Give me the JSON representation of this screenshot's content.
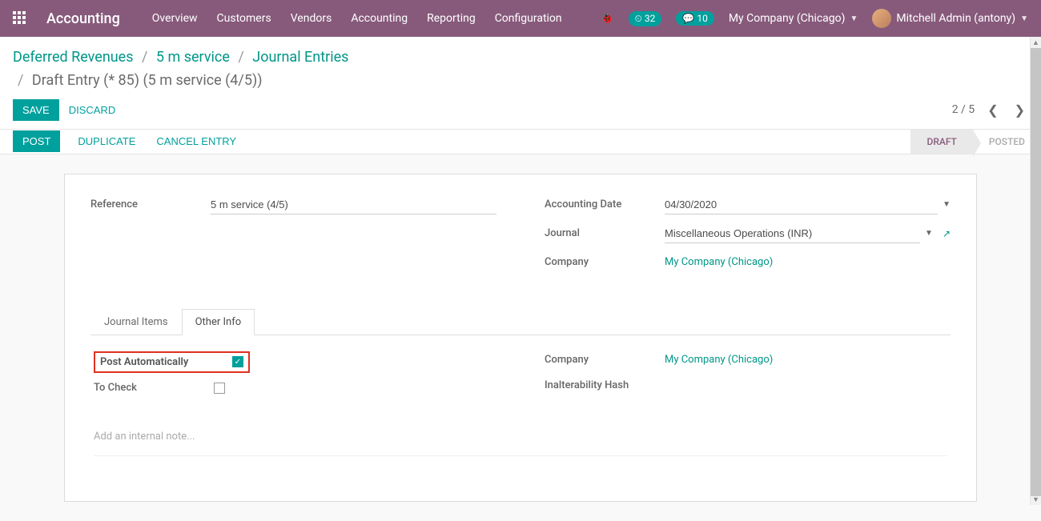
{
  "navbar": {
    "app_name": "Accounting",
    "menu": [
      "Overview",
      "Customers",
      "Vendors",
      "Accounting",
      "Reporting",
      "Configuration"
    ],
    "activity_count": "32",
    "message_count": "10",
    "company": "My Company (Chicago)",
    "user": "Mitchell Admin (antony)"
  },
  "breadcrumb": {
    "items": [
      "Deferred Revenues",
      "5 m service",
      "Journal Entries"
    ],
    "current": "Draft Entry (* 85) (5 m service (4/5))"
  },
  "control": {
    "save": "SAVE",
    "discard": "DISCARD",
    "pager": "2 / 5"
  },
  "actions": {
    "post": "POST",
    "duplicate": "DUPLICATE",
    "cancel": "CANCEL ENTRY",
    "status_draft": "DRAFT",
    "status_posted": "POSTED"
  },
  "form": {
    "reference_label": "Reference",
    "reference_value": "5 m service (4/5)",
    "date_label": "Accounting Date",
    "date_value": "04/30/2020",
    "journal_label": "Journal",
    "journal_value": "Miscellaneous Operations (INR)",
    "company_label": "Company",
    "company_value": "My Company (Chicago)"
  },
  "tabs": {
    "items": "Journal Items",
    "other": "Other Info"
  },
  "other_info": {
    "post_auto_label": "Post Automatically",
    "to_check_label": "To Check",
    "company_label": "Company",
    "company_value": "My Company (Chicago)",
    "hash_label": "Inalterability Hash",
    "note_placeholder": "Add an internal note..."
  }
}
